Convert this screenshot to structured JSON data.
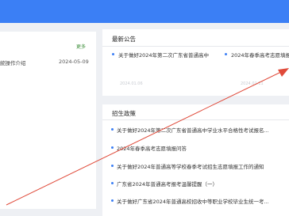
{
  "left_panel": {
    "more_label": "更多",
    "rows": [
      {
        "text": "統操作介绍",
        "date": "2024-05-09"
      }
    ]
  },
  "notices": {
    "title": "最新公告",
    "items": [
      {
        "text": "关于做好2024年第二次广东省普通高中",
        "date": "2024.01.06"
      },
      {
        "text": "2024年春季高考志愿填报",
        "date": "2024.02.11"
      }
    ]
  },
  "policy": {
    "title": "招生政策",
    "items": [
      {
        "text": "关于做好2024年第二次广东省普通高中学业水平合格性考试报名..."
      },
      {
        "text": "2024年春季高考志愿填报问答"
      },
      {
        "text": "关于做好2024年普通高等学校春季考试招生志愿填报工作的通知"
      },
      {
        "text": "广东省2024年普通高考报考温馨提醒（一）"
      },
      {
        "text": "关于做好广东省2024年普通高校招收中等职业学校毕业生统一考..."
      }
    ]
  },
  "colors": {
    "header": "#3b7ff5",
    "accent": "#3b7ff5",
    "more_link": "#3d8e3a",
    "arrow": "#e04a3a"
  }
}
